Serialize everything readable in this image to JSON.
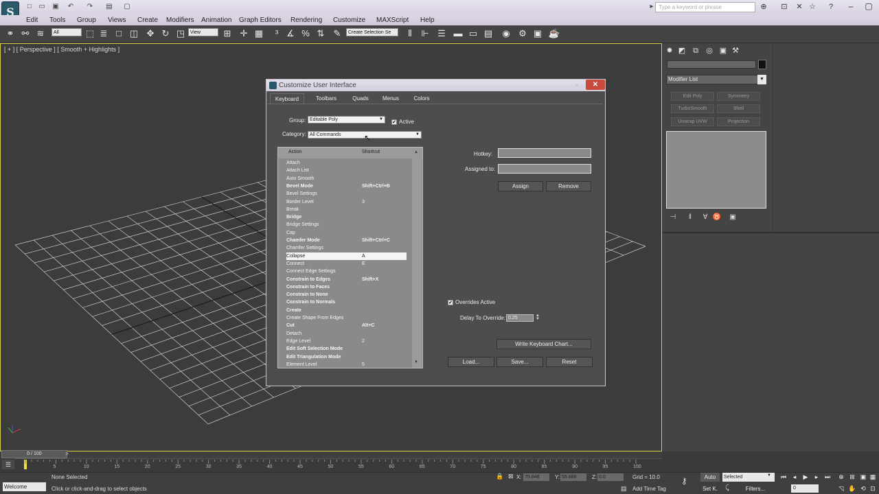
{
  "titlebar": {
    "logo": "S",
    "search_placeholder": "Type a keyword or phrase",
    "icons": [
      "new-icon",
      "open-icon",
      "save-icon",
      "undo-icon",
      "redo-icon",
      "project-icon",
      "workspace-icon",
      "play-icon",
      "binoculars-icon",
      "subscription-icon",
      "close-icon",
      "star-icon",
      "help-icon"
    ]
  },
  "menu": [
    "Edit",
    "Tools",
    "Group",
    "Views",
    "Create",
    "Modifiers",
    "Animation",
    "Graph Editors",
    "Rendering",
    "Customize",
    "MAXScript",
    "Help"
  ],
  "toolbar": {
    "filter_select": "All",
    "ref_coord": "View",
    "named_selection": "Create Selection Se"
  },
  "viewport": {
    "label": "[ + ] [ Perspective ] [ Smooth + Highlights ]"
  },
  "command_panel": {
    "modifier_list": "Modifier List",
    "buttons": [
      "Edit Poly",
      "Symmetry",
      "TurboSmooth",
      "Shell",
      "Unwrap UVW",
      "Projection"
    ]
  },
  "dialog": {
    "title": "Customize User Interface",
    "tabs": [
      "Keyboard",
      "Toolbars",
      "Quads",
      "Menus",
      "Colors"
    ],
    "group_label": "Group:",
    "group_value": "Editable Poly",
    "active_label": "Active",
    "active_checked": "✔",
    "category_label": "Category:",
    "category_value": "All Commands",
    "col_action": "Action",
    "col_shortcut": "Shortcut",
    "rows": [
      {
        "action": "Attach",
        "shortcut": "",
        "bold": false
      },
      {
        "action": "Attach List",
        "shortcut": "",
        "bold": false
      },
      {
        "action": "Auto Smooth",
        "shortcut": "",
        "bold": false
      },
      {
        "action": "Bevel Mode",
        "shortcut": "Shift+Ctrl+B",
        "bold": true
      },
      {
        "action": "Bevel Settings",
        "shortcut": "",
        "bold": false
      },
      {
        "action": "Border Level",
        "shortcut": "3",
        "bold": false
      },
      {
        "action": "Break",
        "shortcut": "",
        "bold": false
      },
      {
        "action": "Bridge",
        "shortcut": "",
        "bold": true
      },
      {
        "action": "Bridge Settings",
        "shortcut": "",
        "bold": false
      },
      {
        "action": "Cap",
        "shortcut": "",
        "bold": false
      },
      {
        "action": "Chamfer Mode",
        "shortcut": "Shift+Ctrl+C",
        "bold": true
      },
      {
        "action": "Chamfer Settings",
        "shortcut": "",
        "bold": false
      },
      {
        "action": "Collapse",
        "shortcut": "A",
        "bold": false,
        "selected": true
      },
      {
        "action": "Connect",
        "shortcut": "E",
        "bold": false
      },
      {
        "action": "Connect Edge Settings",
        "shortcut": "",
        "bold": false
      },
      {
        "action": "Constrain to Edges",
        "shortcut": "Shift+X",
        "bold": true
      },
      {
        "action": "Constrain to Faces",
        "shortcut": "",
        "bold": true
      },
      {
        "action": "Constrain to None",
        "shortcut": "",
        "bold": true
      },
      {
        "action": "Constrain to Normals",
        "shortcut": "",
        "bold": true
      },
      {
        "action": "Create",
        "shortcut": "",
        "bold": true
      },
      {
        "action": "Create Shape From Edges",
        "shortcut": "",
        "bold": false
      },
      {
        "action": "Cut",
        "shortcut": "Alt+C",
        "bold": true
      },
      {
        "action": "Detach",
        "shortcut": "",
        "bold": false
      },
      {
        "action": "Edge Level",
        "shortcut": "2",
        "bold": false
      },
      {
        "action": "Edit Soft Selection Mode",
        "shortcut": "",
        "bold": true
      },
      {
        "action": "Edit Triangulation Mode",
        "shortcut": "",
        "bold": true
      },
      {
        "action": "Element Level",
        "shortcut": "5",
        "bold": false
      }
    ],
    "hotkey_label": "Hotkey:",
    "assigned_label": "Assigned to:",
    "assign_btn": "Assign",
    "remove_btn": "Remove",
    "overrides_label": "Overrides Active",
    "overrides_checked": "✔",
    "delay_label": "Delay To Override:",
    "delay_value": "0.25",
    "write_chart_btn": "Write Keyboard Chart...",
    "load_btn": "Load...",
    "save_btn": "Save...",
    "reset_btn": "Reset"
  },
  "timeline": {
    "frame_display": "0 / 100",
    "ticks": [
      "0",
      "5",
      "10",
      "15",
      "20",
      "25",
      "30",
      "35",
      "40",
      "45",
      "50",
      "55",
      "60",
      "65",
      "70",
      "75",
      "80",
      "85",
      "90",
      "95",
      "100"
    ]
  },
  "status": {
    "welcome": "Welcome",
    "line1": "None Selected",
    "line2": "Click or click-and-drag to select objects",
    "x_label": "X:",
    "x_value": "75.848",
    "y_label": "Y:",
    "y_value": "55.888",
    "z_label": "Z:",
    "z_value": "0.0",
    "grid": "Grid = 10.0",
    "add_time_tag": "Add Time Tag",
    "auto": "Auto",
    "set_key": "Set K.",
    "selected": "Selected",
    "filters": "Filters...",
    "frame": "0"
  },
  "colors": {
    "viewport_border": "#d8d24a",
    "close_button": "#c94a3c",
    "keyframe": "#f0e040"
  }
}
